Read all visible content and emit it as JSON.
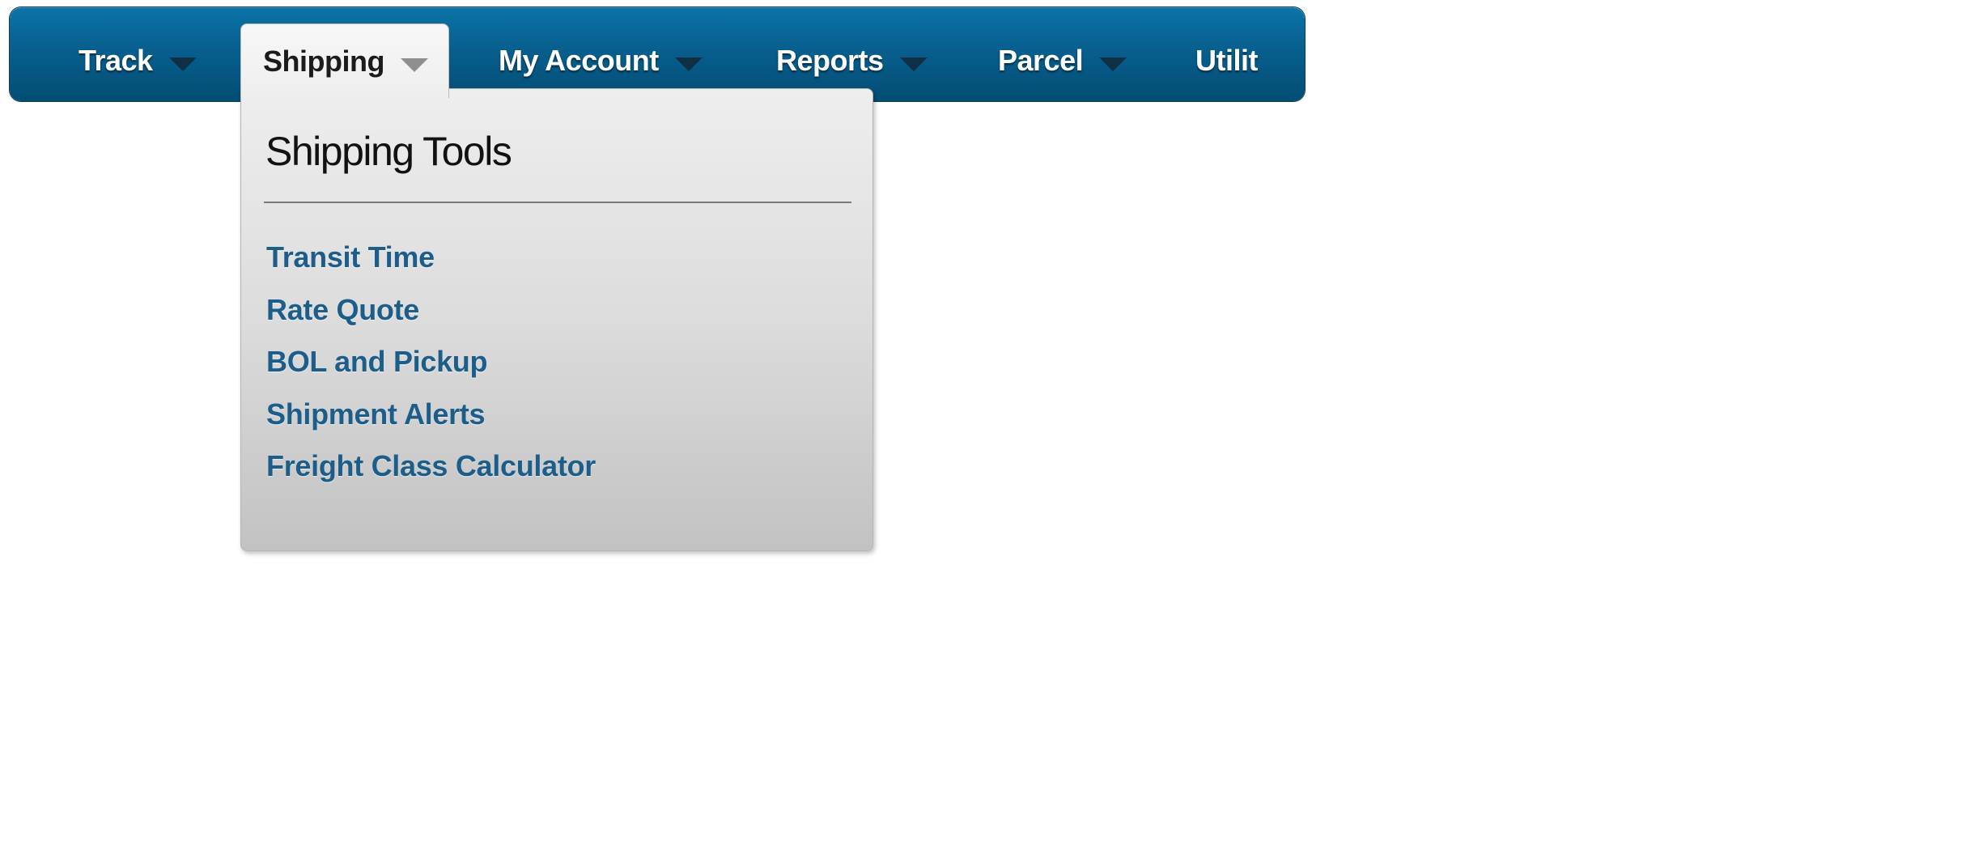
{
  "nav": {
    "items": [
      {
        "label": "Track"
      },
      {
        "label": "Shipping"
      },
      {
        "label": "My Account"
      },
      {
        "label": "Reports"
      },
      {
        "label": "Parcel"
      },
      {
        "label": "Utilit"
      }
    ],
    "active_item": "Shipping"
  },
  "dropdown": {
    "title": "Shipping Tools",
    "links": [
      {
        "label": "Transit Time"
      },
      {
        "label": "Rate Quote"
      },
      {
        "label": "BOL and Pickup"
      },
      {
        "label": "Shipment Alerts"
      },
      {
        "label": "Freight Class Calculator"
      }
    ]
  },
  "icons": {
    "nav_caret": "chevron-down-icon"
  },
  "colors": {
    "nav_background": "#075f8e",
    "nav_text": "#ffffff",
    "active_tab_background": "#eeeeee",
    "dropdown_link": "#1c5d8a",
    "dropdown_title": "#111111"
  }
}
